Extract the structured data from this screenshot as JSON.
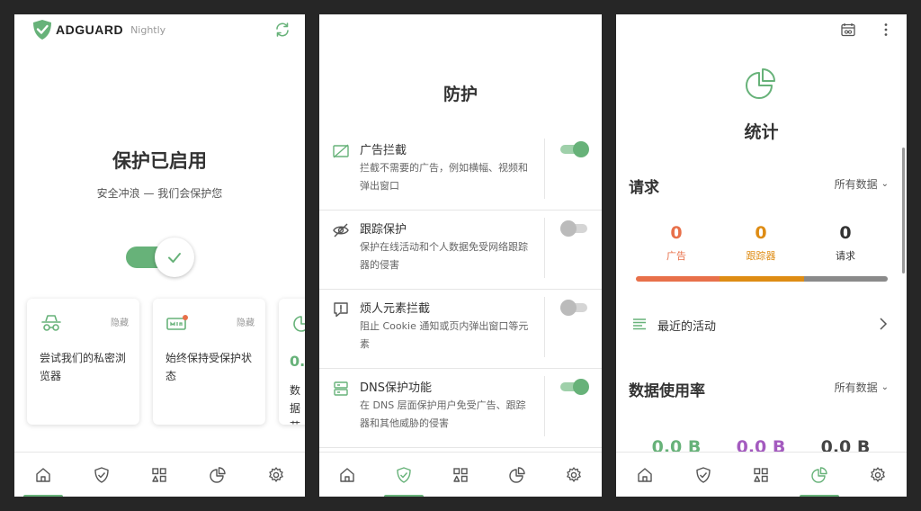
{
  "home": {
    "brand_name": "ADGUARD",
    "brand_tag": "Nightly",
    "title": "保护已启用",
    "subtitle": "安全冲浪 — 我们会保护您",
    "cards": [
      {
        "hide": "隐藏",
        "text": "尝试我们的私密浏览器"
      },
      {
        "hide": "隐藏",
        "text": "始终保持受保护状态"
      }
    ],
    "card3": {
      "value": "0.",
      "text": "数据节省"
    }
  },
  "protection": {
    "title": "防护",
    "items": [
      {
        "title": "广告拦截",
        "desc": "拦截不需要的广告，例如横幅、视频和弹出窗口",
        "enabled": true
      },
      {
        "title": "跟踪保护",
        "desc": "保护在线活动和个人数据免受网络跟踪器的侵害",
        "enabled": false
      },
      {
        "title": "烦人元素拦截",
        "desc": "阻止 Cookie 通知或页内弹出窗口等元素",
        "enabled": false
      },
      {
        "title": "DNS保护功能",
        "desc": "在 DNS 层面保护用户免受广告、跟踪器和其他威胁的侵害",
        "enabled": true
      }
    ]
  },
  "stats": {
    "title": "统计",
    "requests_section": "请求",
    "filter_label": "所有数据",
    "counters": [
      {
        "value": "0",
        "label": "广告",
        "color": "#e8704a"
      },
      {
        "value": "0",
        "label": "跟踪器",
        "color": "#de8c14"
      },
      {
        "value": "0",
        "label": "请求",
        "color": "#333333"
      }
    ],
    "recent_activity": "最近的活动",
    "data_usage_section": "数据使用率",
    "data_filter_label": "所有数据",
    "data_values": [
      {
        "value": "0.0 B",
        "color": "#67b279"
      },
      {
        "value": "0.0 B",
        "color": "#a45bbf"
      },
      {
        "value": "0.0 B",
        "color": "#444444"
      }
    ]
  },
  "colors": {
    "accent": "#67b279",
    "ads_bar": "#e8704a",
    "trackers_bar": "#de8c14",
    "requests_bar": "#8a8a8a"
  },
  "nav_icons": [
    "home-icon",
    "shield-icon",
    "apps-icon",
    "statistics-icon",
    "settings-icon"
  ]
}
